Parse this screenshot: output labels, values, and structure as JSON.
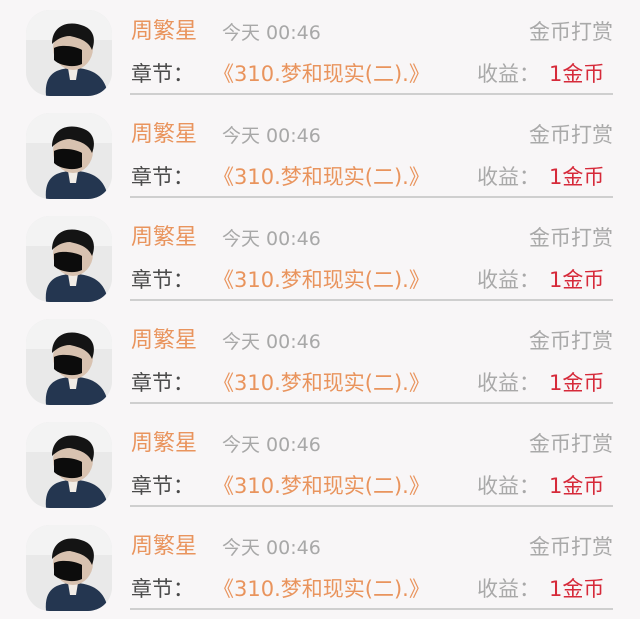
{
  "items": [
    {
      "name": "周繁星",
      "time": "今天 00:46",
      "type": "金币打赏",
      "chapter_label": "章节：",
      "chapter_title": "《310.梦和现实(二).》",
      "earnings_label": "收益：",
      "earnings_value": "1金币"
    },
    {
      "name": "周繁星",
      "time": "今天 00:46",
      "type": "金币打赏",
      "chapter_label": "章节：",
      "chapter_title": "《310.梦和现实(二).》",
      "earnings_label": "收益：",
      "earnings_value": "1金币"
    },
    {
      "name": "周繁星",
      "time": "今天 00:46",
      "type": "金币打赏",
      "chapter_label": "章节：",
      "chapter_title": "《310.梦和现实(二).》",
      "earnings_label": "收益：",
      "earnings_value": "1金币"
    },
    {
      "name": "周繁星",
      "time": "今天 00:46",
      "type": "金币打赏",
      "chapter_label": "章节：",
      "chapter_title": "《310.梦和现实(二).》",
      "earnings_label": "收益：",
      "earnings_value": "1金币"
    },
    {
      "name": "周繁星",
      "time": "今天 00:46",
      "type": "金币打赏",
      "chapter_label": "章节：",
      "chapter_title": "《310.梦和现实(二).》",
      "earnings_label": "收益：",
      "earnings_value": "1金币"
    },
    {
      "name": "周繁星",
      "time": "今天 00:46",
      "type": "金币打赏",
      "chapter_label": "章节：",
      "chapter_title": "《310.梦和现实(二).》",
      "earnings_label": "收益：",
      "earnings_value": "1金币"
    }
  ],
  "colors": {
    "name": "#e9945d",
    "chapter_title": "#e9945d",
    "earnings_value": "#d62a3a",
    "muted": "#a9a9a9",
    "label": "#4a4a4a",
    "background": "#f8f6f7"
  }
}
